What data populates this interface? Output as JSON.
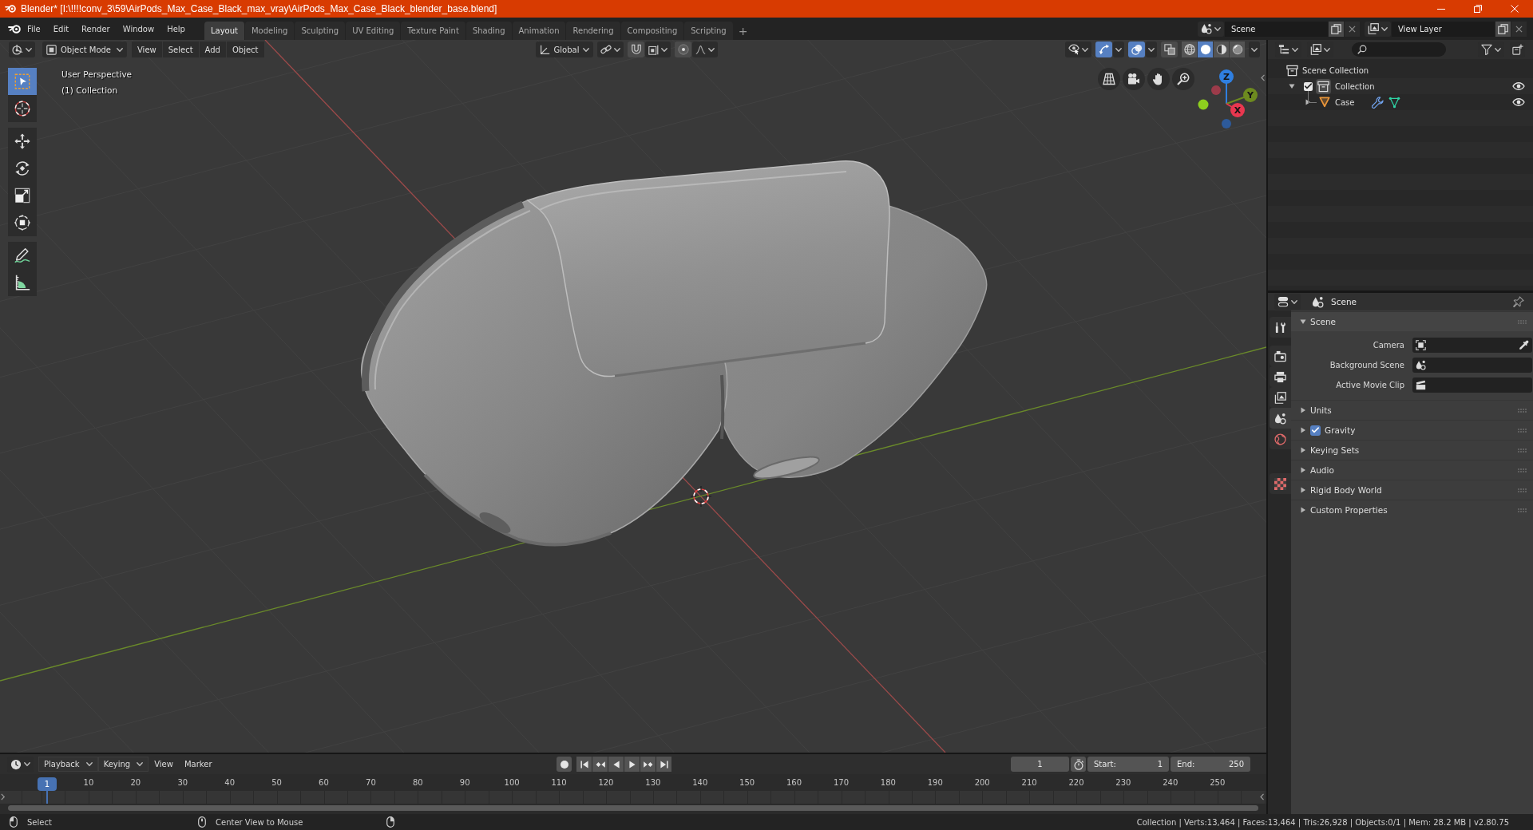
{
  "window": {
    "title": "Blender* [I:\\!!!!conv_3\\59\\AirPods_Max_Case_Black_max_vray\\AirPods_Max_Case_Black_blender_base.blend]"
  },
  "menu": [
    "File",
    "Edit",
    "Render",
    "Window",
    "Help"
  ],
  "workspace_tabs": [
    {
      "label": "Layout",
      "selected": true
    },
    {
      "label": "Modeling",
      "selected": false
    },
    {
      "label": "Sculpting",
      "selected": false
    },
    {
      "label": "UV Editing",
      "selected": false
    },
    {
      "label": "Texture Paint",
      "selected": false
    },
    {
      "label": "Shading",
      "selected": false
    },
    {
      "label": "Animation",
      "selected": false
    },
    {
      "label": "Rendering",
      "selected": false
    },
    {
      "label": "Compositing",
      "selected": false
    },
    {
      "label": "Scripting",
      "selected": false
    }
  ],
  "add_workspace": "+",
  "scene": {
    "value": "Scene"
  },
  "view_layer": {
    "value": "View Layer"
  },
  "viewport": {
    "mode": "Object Mode",
    "menus": [
      "View",
      "Select",
      "Add",
      "Object"
    ],
    "orientation": "Global",
    "toggles": [
      {
        "kind": "snap",
        "on": false
      },
      {
        "kind": "proportional",
        "on": false
      },
      {
        "kind": "gizmos",
        "on": true
      },
      {
        "kind": "overlays",
        "on": true
      },
      {
        "kind": "xray",
        "on": false
      }
    ],
    "shading": [
      {
        "kind": "wireframe",
        "selected": false
      },
      {
        "kind": "solid",
        "selected": true
      },
      {
        "kind": "material",
        "selected": false
      },
      {
        "kind": "rendered",
        "selected": false
      }
    ],
    "tools": [
      {
        "kind": "select",
        "selected": true
      },
      {
        "kind": "cursor",
        "selected": false
      },
      {
        "kind": "move",
        "selected": false
      },
      {
        "kind": "rotate",
        "selected": false
      },
      {
        "kind": "scale",
        "selected": false
      },
      {
        "kind": "transform",
        "selected": false
      },
      {
        "kind": "annotate",
        "selected": false
      },
      {
        "kind": "measure",
        "selected": false
      }
    ],
    "info": [
      "User Perspective",
      "(1) Collection"
    ],
    "axes": [
      {
        "label": "Z",
        "color": "#2f7fe0"
      },
      {
        "label": "Y",
        "color": "#6d8a1f"
      },
      {
        "label": "X",
        "color": "#e8374f"
      }
    ]
  },
  "outliner": {
    "tree": [
      {
        "label": "Scene Collection",
        "children": [
          {
            "label": "Collection",
            "expanded": true,
            "checked": true,
            "visible": true,
            "children": [
              {
                "label": "Case",
                "expanded": false,
                "visible": true
              }
            ]
          }
        ]
      }
    ]
  },
  "properties": {
    "title": "Scene",
    "tabs": [
      {
        "kind": "tool",
        "selected": false
      },
      {
        "kind": "render",
        "selected": false
      },
      {
        "kind": "output",
        "selected": false
      },
      {
        "kind": "view_layer",
        "selected": false
      },
      {
        "kind": "scene",
        "selected": true
      },
      {
        "kind": "world",
        "selected": false
      },
      {
        "kind": "texture",
        "selected": false
      }
    ],
    "panels": [
      {
        "title": "Scene",
        "kind": "plain",
        "expanded": true,
        "fields": [
          {
            "label": "Camera",
            "kind": "camera"
          },
          {
            "label": "Background Scene",
            "kind": "scene"
          },
          {
            "label": "Active Movie Clip",
            "kind": "clip"
          }
        ]
      },
      {
        "title": "Units",
        "kind": "plain",
        "expanded": false
      },
      {
        "title": "Gravity",
        "kind": "checkbox",
        "checked": true,
        "expanded": false
      },
      {
        "title": "Keying Sets",
        "kind": "plain",
        "expanded": false
      },
      {
        "title": "Audio",
        "kind": "plain",
        "expanded": false
      },
      {
        "title": "Rigid Body World",
        "kind": "plain",
        "expanded": false
      },
      {
        "title": "Custom Properties",
        "kind": "plain",
        "expanded": false
      }
    ]
  },
  "timeline": {
    "menus": [
      {
        "label": "Playback",
        "kind": "dropdown"
      },
      {
        "label": "Keying",
        "kind": "dropdown"
      },
      {
        "label": "View",
        "kind": "menu"
      },
      {
        "label": "Marker",
        "kind": "menu"
      }
    ],
    "current_frame": "1",
    "start": {
      "label": "Start:",
      "value": "1"
    },
    "end": {
      "label": "End:",
      "value": "250"
    },
    "playhead": "1",
    "ticks": [
      "10",
      "20",
      "30",
      "40",
      "50",
      "60",
      "70",
      "80",
      "90",
      "100",
      "110",
      "120",
      "130",
      "140",
      "150",
      "160",
      "170",
      "180",
      "190",
      "200",
      "210",
      "220",
      "230",
      "240",
      "250"
    ]
  },
  "status_bar": {
    "hints": [
      {
        "kind": "left_click",
        "label": "Select"
      },
      {
        "kind": "middle_click",
        "label": "Center View to Mouse"
      },
      {
        "kind": "right_click"
      }
    ],
    "stats": "Collection | Verts:13,464 | Faces:13,464 | Tris:26,928 | Objects:0/1 | Mem: 28.2 MB | v2.80.75"
  }
}
